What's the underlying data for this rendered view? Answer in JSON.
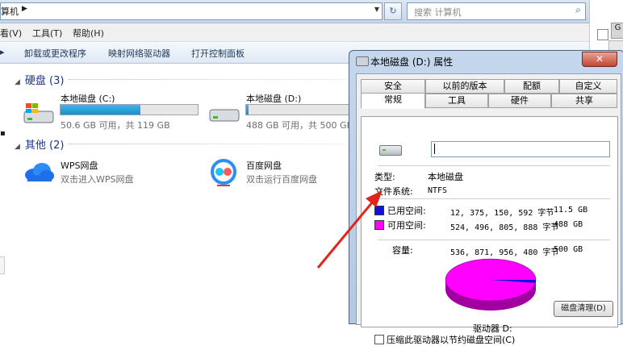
{
  "explorer": {
    "address_text": "算机",
    "search_placeholder": "搜索 计算机",
    "menu": [
      "看(V)",
      "工具(T)",
      "帮助(H)"
    ],
    "toolbar": [
      "卸载或更改程序",
      "映射网络驱动器",
      "打开控制面板"
    ],
    "groups": {
      "hard_disks": {
        "title": "硬盘 (3)"
      },
      "other": {
        "title": "其他 (2)"
      }
    },
    "drives": [
      {
        "name": "本地磁盘 (C:)",
        "info": "50.6 GB 可用，共 119 GB",
        "used_fraction": 0.58
      },
      {
        "name": "本地磁盘 (D:)",
        "info": "488 GB 可用，共 500 GB",
        "used_fraction": 0.02
      }
    ],
    "others": [
      {
        "name": "WPS网盘",
        "desc": "双击进入WPS网盘"
      },
      {
        "name": "百度网盘",
        "desc": "双击运行百度网盘"
      }
    ]
  },
  "dialog": {
    "title": "本地磁盘 (D:) 属性",
    "close": "✕",
    "tabs_row1": [
      "安全",
      "以前的版本",
      "配额",
      "自定义"
    ],
    "tabs_row2": [
      "常规",
      "工具",
      "硬件",
      "共享"
    ],
    "type_label": "类型:",
    "type_value": "本地磁盘",
    "fs_label": "文件系统:",
    "fs_value": "NTFS",
    "used_label": "已用空间:",
    "used_bytes": "12, 375, 150, 592 字节",
    "used_size": "11.5 GB",
    "free_label": "可用空间:",
    "free_bytes": "524, 496, 805, 888 字节",
    "free_size": "488 GB",
    "capacity_label": "容量:",
    "capacity_bytes": "536, 871, 956, 480 字节",
    "capacity_size": "500 GB",
    "drive_label": "驱动器 D:",
    "cleanup_button": "磁盘清理(D)",
    "compress_label": "压缩此驱动器以节约磁盘空间(C)",
    "used_fraction": 0.023,
    "colors": {
      "used": "#1010e0",
      "free": "#ff00ff"
    }
  }
}
